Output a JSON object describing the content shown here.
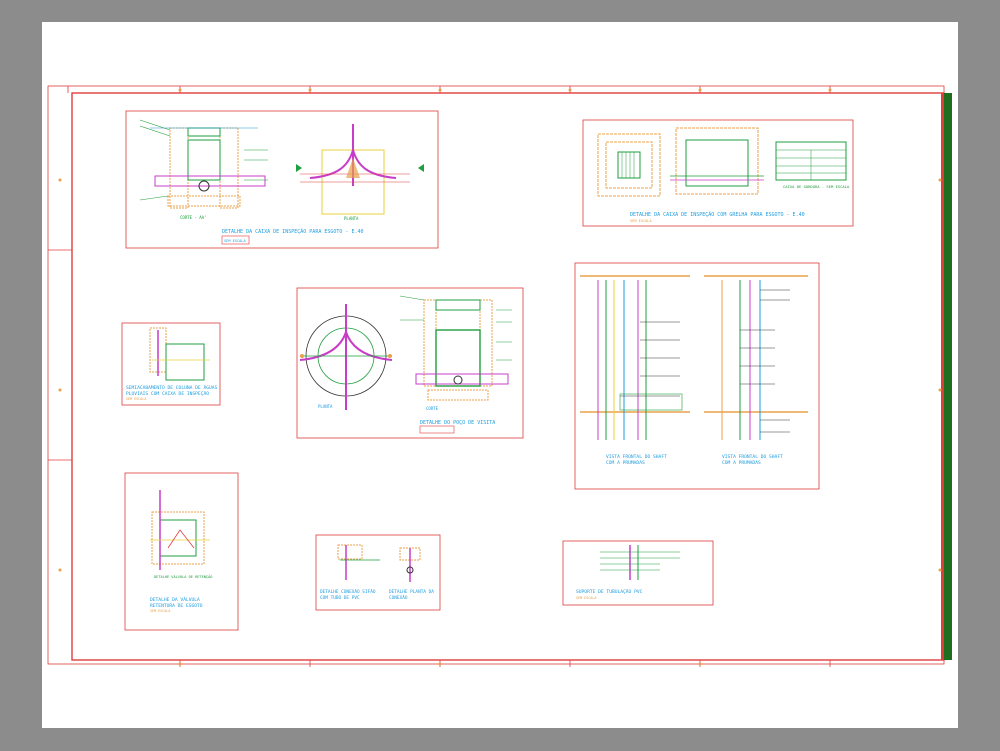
{
  "colors": {
    "frame": "#e03c3c",
    "text": "#1e9de0",
    "green": "#1f9e3c",
    "brick": "#e8a04a",
    "yellow": "#e8d23a",
    "magenta": "#c83cc8",
    "dark_green_strip": "#1f6e1f",
    "background": "#8c8c8c",
    "paper": "#ffffff"
  },
  "details": {
    "d1": {
      "title": "DETALHE DA CAIXA DE INSPEÇÃO PARA ESGOTO - E.40",
      "sub": "SEM ESCALA",
      "corte": "CORTE - AA'",
      "planta": "PLANTA"
    },
    "d2": {
      "title": "DETALHE DA CAIXA DE INSPEÇÃO COM GRELHA PARA ESGOTO - E.40",
      "sub": "SEM ESCALA",
      "table": "CAIXA DE GORDURA - SEM ESCALA"
    },
    "d3": {
      "title": "DETALHE DO POÇO DE VISITA",
      "planta": "PLANTA",
      "corte": "CORTE"
    },
    "d4": {
      "title1": "SEMIACABAMENTO DE COLUNA DE ÁGUAS",
      "title2": "PLUVIAIS COM CAIXA DE INSPEÇÃO",
      "sub": "SEM ESCALA"
    },
    "d5": {
      "title1": "VISTA FRONTAL DO SHAFT",
      "title2": "COM A PRUMADAS",
      "title3": "VISTA FRONTAL DO SHAFT",
      "title4": "COM A PRUMADAS"
    },
    "d6": {
      "title1": "DETALHE DA VÁLVULA",
      "title2": "RETENTORA DE ESGOTO",
      "sub": "SEM ESCALA",
      "label": "DETALHE VÁLVULA DE RETENÇÃO"
    },
    "d7": {
      "title1": "DETALHE CONEXÃO SIFÃO",
      "title2": "COM TUBO DE PVC",
      "title3": "DETALHE PLANTA DA",
      "title4": "CONEXÃO"
    },
    "d8": {
      "title": "SUPORTE DE TUBULAÇÃO PVC",
      "sub": "SEM ESCALA"
    }
  }
}
